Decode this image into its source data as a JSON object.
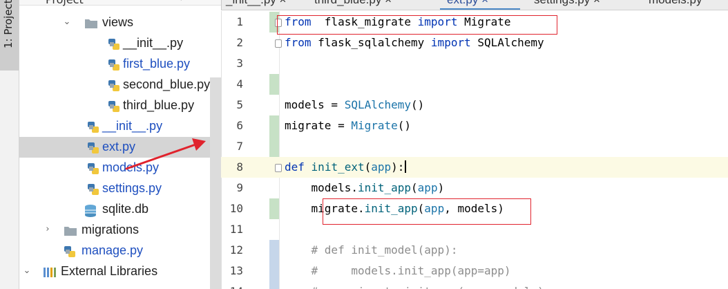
{
  "toolstrip": {
    "project_tab_label": "1: Project"
  },
  "project_panel": {
    "header_title": "Project",
    "header_dots": "⋯",
    "header_gear": "⚙",
    "tree": [
      {
        "label": "views",
        "icon": "folder-icon",
        "arrow": "⌄",
        "color": "#1f1f1f"
      },
      {
        "label": "__init__.py",
        "icon": "python-file-icon",
        "arrow": "",
        "color": "#1f1f1f"
      },
      {
        "label": "first_blue.py",
        "icon": "python-file-icon",
        "arrow": "",
        "color": "#1e4fbf"
      },
      {
        "label": "second_blue.py",
        "icon": "python-file-icon",
        "arrow": "",
        "color": "#1f1f1f"
      },
      {
        "label": "third_blue.py",
        "icon": "python-file-icon",
        "arrow": "",
        "color": "#1f1f1f"
      },
      {
        "label": "__init__.py",
        "icon": "python-file-icon",
        "arrow": "",
        "color": "#1e4fbf"
      },
      {
        "label": "ext.py",
        "icon": "python-file-icon",
        "arrow": "",
        "color": "#1e4fbf"
      },
      {
        "label": "models.py",
        "icon": "python-file-icon",
        "arrow": "",
        "color": "#1e4fbf"
      },
      {
        "label": "settings.py",
        "icon": "python-file-icon",
        "arrow": "",
        "color": "#1e4fbf"
      },
      {
        "label": "sqlite.db",
        "icon": "database-icon",
        "arrow": "",
        "color": "#1f1f1f"
      },
      {
        "label": "migrations",
        "icon": "folder-icon",
        "arrow": "›",
        "color": "#1f1f1f"
      },
      {
        "label": "manage.py",
        "icon": "python-file-icon",
        "arrow": "",
        "color": "#1e4fbf"
      },
      {
        "label": "External Libraries",
        "icon": "libraries-icon",
        "arrow": "⌄",
        "color": "#1f1f1f"
      }
    ]
  },
  "tabs": [
    {
      "label": "_init__.py ×"
    },
    {
      "label": "third_blue.py ×"
    },
    {
      "label": "ext.py ×"
    },
    {
      "label": "settings.py ×"
    },
    {
      "label": "models.py"
    }
  ],
  "code_lines": [
    {
      "no": "1",
      "tokens": [
        [
          "kw",
          "from"
        ],
        [
          "",
          "  flask_migrate "
        ],
        [
          "kw",
          "import"
        ],
        [
          "",
          " Migrate"
        ]
      ]
    },
    {
      "no": "2",
      "tokens": [
        [
          "kw",
          "from"
        ],
        [
          "",
          " flask_sqlalchemy "
        ],
        [
          "kw",
          "import"
        ],
        [
          "",
          " SQLAlchemy"
        ]
      ]
    },
    {
      "no": "3",
      "tokens": []
    },
    {
      "no": "4",
      "tokens": []
    },
    {
      "no": "5",
      "tokens": [
        [
          "",
          "models = "
        ],
        [
          "cls",
          "SQLAlchemy"
        ],
        [
          "",
          "()"
        ]
      ]
    },
    {
      "no": "6",
      "tokens": [
        [
          "",
          "migrate = "
        ],
        [
          "cls",
          "Migrate"
        ],
        [
          "",
          "()"
        ]
      ]
    },
    {
      "no": "7",
      "tokens": []
    },
    {
      "no": "8",
      "tokens": [
        [
          "kw",
          "def"
        ],
        [
          "",
          " "
        ],
        [
          "fn",
          "init_ext"
        ],
        [
          "",
          "("
        ],
        [
          "cls",
          "app"
        ],
        [
          "",
          "):"
        ]
      ]
    },
    {
      "no": "9",
      "tokens": [
        [
          "",
          "    models."
        ],
        [
          "fn",
          "init_app"
        ],
        [
          "",
          "("
        ],
        [
          "cls",
          "app"
        ],
        [
          "",
          ")"
        ]
      ]
    },
    {
      "no": "10",
      "tokens": [
        [
          "",
          "    migrate."
        ],
        [
          "fn",
          "init_app"
        ],
        [
          "",
          "("
        ],
        [
          "cls",
          "app"
        ],
        [
          "",
          ", models)"
        ]
      ]
    },
    {
      "no": "11",
      "tokens": []
    },
    {
      "no": "12",
      "tokens": [
        [
          "cm",
          "    # def init_model(app):"
        ]
      ]
    },
    {
      "no": "13",
      "tokens": [
        [
          "cm",
          "    #     models.init_app(app=app)"
        ]
      ]
    },
    {
      "no": "14",
      "tokens": [
        [
          "cm",
          "    #     migrate.init_app(app, models)"
        ]
      ]
    }
  ],
  "colors": {
    "highlight_box": "#e0232d",
    "arrow": "#e0232d",
    "current_line": "#fcfae4",
    "change_green": "#c7e1c6",
    "change_blue": "#c6d6ea"
  }
}
